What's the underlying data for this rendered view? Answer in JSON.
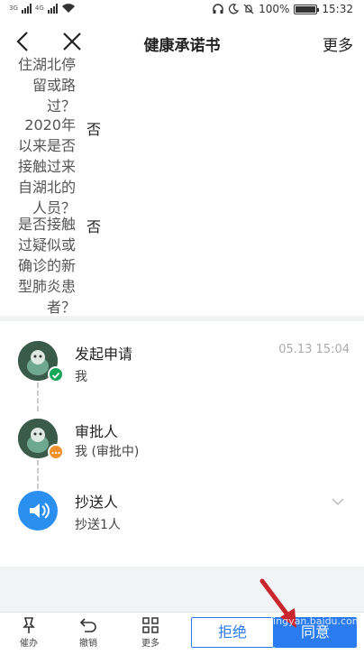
{
  "status_bar": {
    "signal_1": "3G",
    "signal_2": "4G",
    "battery_percent": "100%",
    "time": "15:32"
  },
  "nav": {
    "title": "健康承诺书",
    "more": "更多"
  },
  "form": {
    "rows": [
      {
        "question_lines": [
          "住湖北停",
          "留或路",
          "过？"
        ],
        "answer": ""
      },
      {
        "question_lines": [
          "2020年",
          "以来是否",
          "接触过来",
          "自湖北的",
          "人员？"
        ],
        "answer": "否"
      },
      {
        "question_lines": [
          "是否接触",
          "过疑似或",
          "确诊的新",
          "型肺炎患",
          "者？"
        ],
        "answer": "否"
      }
    ]
  },
  "flow": {
    "steps": [
      {
        "title": "发起申请",
        "subtitle": "我",
        "time": "05.13 15:04"
      },
      {
        "title": "审批人",
        "subtitle": "我 (审批中)"
      },
      {
        "title": "抄送人",
        "subtitle": "抄送1人"
      }
    ]
  },
  "bottom": {
    "tools": [
      "催办",
      "撤销",
      "更多"
    ],
    "reject": "拒绝",
    "agree": "同意"
  },
  "watermark": "jingyan.baidu.com",
  "colors": {
    "accent": "#2b7cf0",
    "approved": "#16a65a",
    "pending": "#f0902c"
  }
}
